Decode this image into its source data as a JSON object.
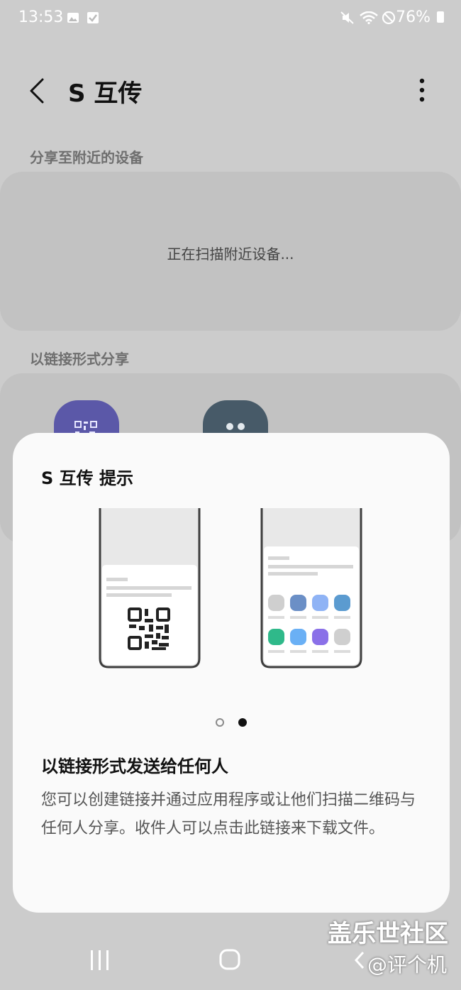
{
  "status_bar": {
    "time": "13:53",
    "battery": "76%"
  },
  "header": {
    "title": "S 互传"
  },
  "nearby": {
    "section_title": "分享至附近的设备",
    "scanning_text": "正在扫描附近设备..."
  },
  "link_share": {
    "section_title": "以链接形式分享"
  },
  "dialog": {
    "title": "S 互传 提示",
    "heading": "以链接形式发送给任何人",
    "body": "您可以创建链接并通过应用程序或让他们扫描二维码与任何人分享。收件人可以点击此链接来下载文件。",
    "page_indicator": {
      "total": 2,
      "current": 2
    }
  },
  "colors": {
    "qr_icon_bg": "#5b58a8",
    "more_icon_bg": "#475a68",
    "app_tile_colors": [
      "#cfcfcf",
      "#6b8fc6",
      "#8fb3f5",
      "#5b9bd0",
      "#2fb98a",
      "#6ab0f5",
      "#8a70e8",
      "#cfcfcf"
    ]
  },
  "watermark": {
    "line1": "盖乐世社区",
    "line2": "@评个机"
  }
}
